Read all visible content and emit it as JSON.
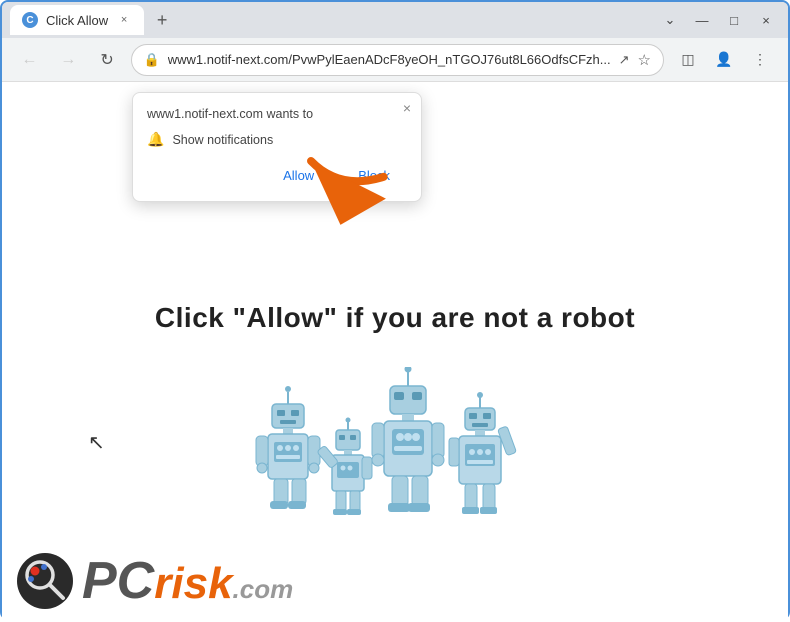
{
  "window": {
    "title": "Click Allow",
    "tab_favicon": "C",
    "close_label": "×",
    "new_tab_label": "+",
    "minimize_label": "—",
    "maximize_label": "□",
    "close_win_label": "×"
  },
  "nav": {
    "back_label": "←",
    "forward_label": "→",
    "refresh_label": "↻",
    "url": "www1.notif-next.com/PvwPylEaenADcF8yeOH_nTGOJ76ut8L66OdfsCFzh...",
    "share_label": "⬆",
    "bookmark_label": "☆",
    "sidebar_label": "◫",
    "profile_label": "👤",
    "menu_label": "⋮"
  },
  "popup": {
    "title": "www1.notif-next.com wants to",
    "close_label": "×",
    "show_notifications_label": "Show notifications",
    "allow_label": "Allow",
    "block_label": "Block"
  },
  "page": {
    "main_text": "Click \"Allow\"   if you are not   a robot"
  },
  "logo": {
    "pc_label": "PC",
    "risk_label": "risk",
    "com_label": ".com"
  },
  "colors": {
    "accent": "#4a90d9",
    "allow_color": "#1a73e8",
    "arrow_color": "#e8630a"
  }
}
